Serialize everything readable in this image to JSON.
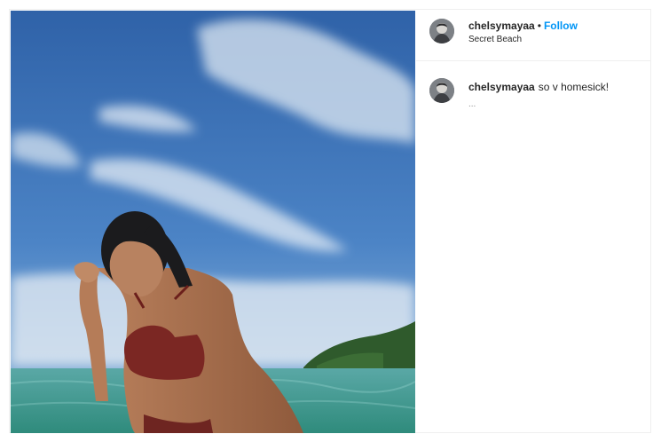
{
  "post": {
    "author": {
      "username": "chelsymayaa",
      "separator": "•",
      "follow_label": "Follow",
      "location": "Secret Beach"
    },
    "caption": {
      "username": "chelsymayaa",
      "text": "so v homesick!",
      "meta": "..."
    },
    "photo": {
      "subject": "woman in red bikini in the sea",
      "sky_color": "#3f74b6",
      "sea_color": "#4fa19b"
    }
  },
  "colors": {
    "follow": "#0095f6",
    "text": "#262626",
    "secondary": "#8e8e8e"
  }
}
